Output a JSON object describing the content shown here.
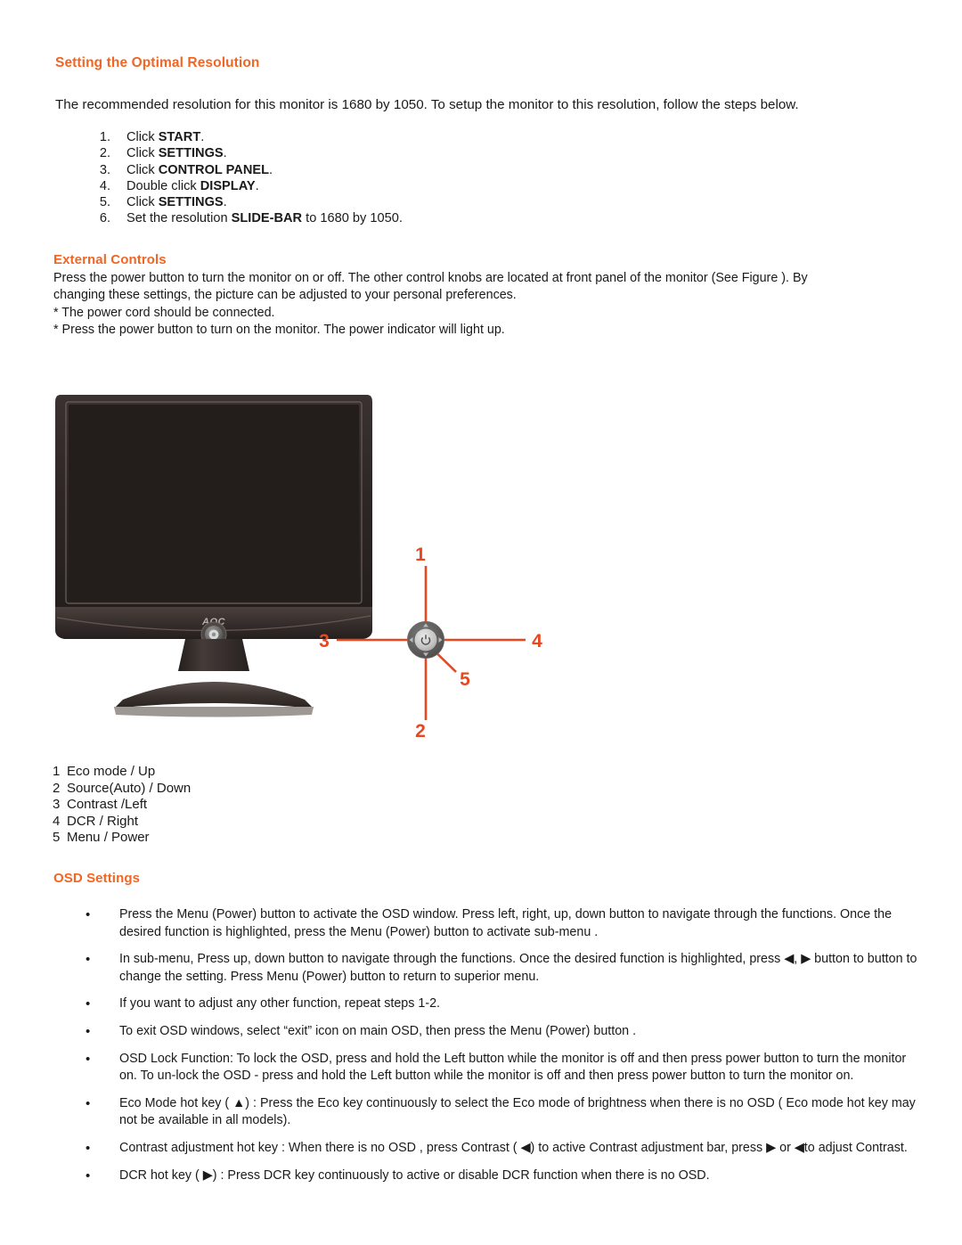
{
  "sections": {
    "optimal_resolution": {
      "heading": "Setting the Optimal Resolution",
      "intro": "The recommended resolution for this monitor is 1680 by 1050. To setup the monitor to this resolution, follow the steps below.",
      "steps": [
        {
          "num": "1.",
          "pre": "Click ",
          "bold": "START",
          "post": "."
        },
        {
          "num": "2.",
          "pre": "Click ",
          "bold": "SETTINGS",
          "post": "."
        },
        {
          "num": "3.",
          "pre": "Click ",
          "bold": "CONTROL PANEL",
          "post": "."
        },
        {
          "num": "4.",
          "pre": "Double click ",
          "bold": "DISPLAY",
          "post": "."
        },
        {
          "num": "5.",
          "pre": "Click ",
          "bold": "SETTINGS",
          "post": "."
        },
        {
          "num": "6.",
          "pre": "Set the resolution ",
          "bold": "SLIDE-BAR",
          "post": " to 1680 by 1050."
        }
      ]
    },
    "external_controls": {
      "heading": "External Controls",
      "lines": [
        "Press the power button to turn the monitor on or off. The other control knobs are located at front panel of the monitor (See Figure ). By",
        "changing these settings, the picture can be adjusted to your personal preferences.",
        "* The power cord should be connected.",
        "* Press the power button to turn on the monitor. The power indicator will light up."
      ]
    },
    "figure": {
      "brand_logo": "AOC",
      "callouts": [
        {
          "id": "1",
          "label": "1"
        },
        {
          "id": "2",
          "label": "2"
        },
        {
          "id": "3",
          "label": "3"
        },
        {
          "id": "4",
          "label": "4"
        },
        {
          "id": "5",
          "label": "5"
        }
      ],
      "callout_color": "#E8471F",
      "bezel_color": "#2b2523",
      "screen_color": "#231d1b"
    },
    "legend": [
      {
        "num": "1",
        "label": "Eco mode / Up"
      },
      {
        "num": "2",
        "label": "Source(Auto) / Down"
      },
      {
        "num": "3",
        "label": "Contrast /Left"
      },
      {
        "num": "4",
        "label": "DCR / Right"
      },
      {
        "num": "5",
        "label": "Menu / Power"
      }
    ],
    "osd_settings": {
      "heading": "OSD Settings",
      "bullet_mark": "•",
      "bullets": [
        "Press the Menu (Power) button to activate the OSD window. Press left, right, up, down button to navigate through the functions. Once the desired function is highlighted, press the Menu (Power) button to activate sub-menu .",
        "In sub-menu, Press up, down button to navigate through the functions. Once the desired function is highlighted, press ◀, ▶ button to button to change the setting. Press Menu (Power) button to return to superior menu.",
        "If you want to adjust any other function, repeat steps 1-2.",
        "To exit  OSD windows, select “exit” icon on main OSD, then press the Menu (Power) button .",
        "OSD Lock Function: To lock the OSD, press and hold the Left button while the monitor is off and then press power button to turn the monitor on. To un-lock the OSD - press and hold the Left button while the monitor is off and then press power button to turn the monitor on.",
        "Eco Mode hot key ( ▲) : Press the Eco key continuously to select the Eco mode of brightness when there is no OSD ( Eco mode hot key may not be available in all models).",
        "Contrast adjustment hot key : When there is no OSD , press Contrast ( ◀) to active Contrast adjustment bar, press ▶ or ◀to adjust Contrast.",
        "DCR hot key ( ▶) : Press DCR key continuously to active or disable DCR function when there is no OSD."
      ]
    }
  },
  "theme": {
    "accent": "#F26522",
    "text": "#1a1a1a",
    "background": "#ffffff"
  }
}
